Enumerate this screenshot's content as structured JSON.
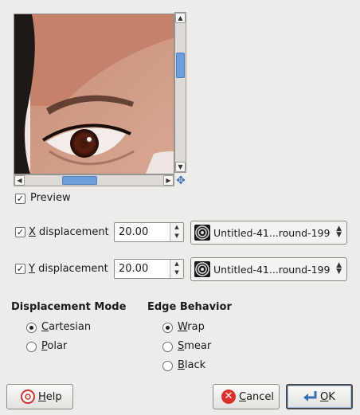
{
  "preview": {
    "label": "Preview",
    "checked": true,
    "image_description_icon": "face-preview-image"
  },
  "x_displacement": {
    "checked": true,
    "label_mnemonic": "X",
    "label_rest": " displacement",
    "value": "20.00",
    "map": "Untitled-41...round-199"
  },
  "y_displacement": {
    "checked": true,
    "label_mnemonic": "Y",
    "label_rest": " displacement",
    "value": "20.00",
    "map": "Untitled-41...round-199"
  },
  "displacement_mode": {
    "title": "Displacement Mode",
    "options": [
      {
        "mnemonic": "C",
        "rest": "artesian",
        "selected": true
      },
      {
        "mnemonic": "P",
        "rest": "olar",
        "selected": false
      }
    ]
  },
  "edge_behavior": {
    "title": "Edge Behavior",
    "options": [
      {
        "mnemonic": "W",
        "rest": "rap",
        "selected": true
      },
      {
        "mnemonic": "S",
        "rest": "mear",
        "selected": false
      },
      {
        "mnemonic": "B",
        "rest": "lack",
        "selected": false
      }
    ]
  },
  "buttons": {
    "help": {
      "mnemonic": "H",
      "rest": "elp",
      "icon": "help-lifebuoy-icon"
    },
    "cancel": {
      "mnemonic": "C",
      "rest": "ancel",
      "icon": "cancel-icon"
    },
    "ok": {
      "mnemonic": "O",
      "rest": "K",
      "icon": "ok-return-icon"
    }
  },
  "colors": {
    "background": "#edeceb",
    "scroll_thumb": "#6e9fda",
    "cancel_red": "#d8322b"
  }
}
